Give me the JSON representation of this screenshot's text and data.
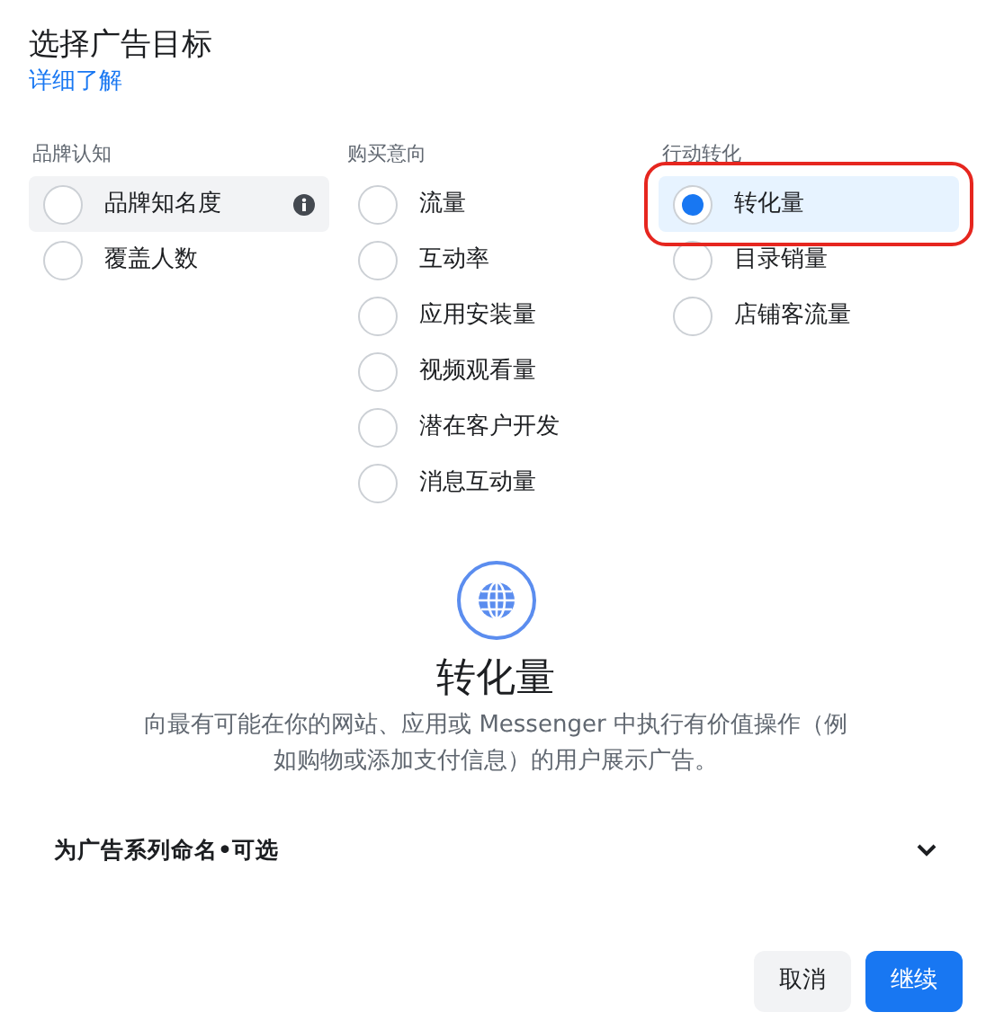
{
  "dialog": {
    "title": "选择广告目标",
    "learn_more": "详细了解"
  },
  "groups": [
    {
      "heading": "品牌认知",
      "options": [
        {
          "label": "品牌知名度",
          "selected": false,
          "hovered": true,
          "info": true,
          "highlighted": false
        },
        {
          "label": "覆盖人数",
          "selected": false,
          "hovered": false,
          "info": false,
          "highlighted": false
        }
      ]
    },
    {
      "heading": "购买意向",
      "options": [
        {
          "label": "流量",
          "selected": false,
          "hovered": false,
          "info": false,
          "highlighted": false
        },
        {
          "label": "互动率",
          "selected": false,
          "hovered": false,
          "info": false,
          "highlighted": false
        },
        {
          "label": "应用安装量",
          "selected": false,
          "hovered": false,
          "info": false,
          "highlighted": false
        },
        {
          "label": "视频观看量",
          "selected": false,
          "hovered": false,
          "info": false,
          "highlighted": false
        },
        {
          "label": "潜在客户开发",
          "selected": false,
          "hovered": false,
          "info": false,
          "highlighted": false
        },
        {
          "label": "消息互动量",
          "selected": false,
          "hovered": false,
          "info": false,
          "highlighted": false
        }
      ]
    },
    {
      "heading": "行动转化",
      "options": [
        {
          "label": "转化量",
          "selected": true,
          "hovered": false,
          "info": false,
          "highlighted": true
        },
        {
          "label": "目录销量",
          "selected": false,
          "hovered": false,
          "info": false,
          "highlighted": false
        },
        {
          "label": "店铺客流量",
          "selected": false,
          "hovered": false,
          "info": false,
          "highlighted": false
        }
      ]
    }
  ],
  "detail": {
    "title": "转化量",
    "description": "向最有可能在你的网站、应用或 Messenger 中执行有价值操作（例如购物或添加支付信息）的用户展示广告。"
  },
  "campaign_name": {
    "label": "为广告系列命名•可选",
    "expanded": false
  },
  "buttons": [
    {
      "label": "取消",
      "kind": "secondary"
    },
    {
      "label": "继续",
      "kind": "primary"
    }
  ]
}
